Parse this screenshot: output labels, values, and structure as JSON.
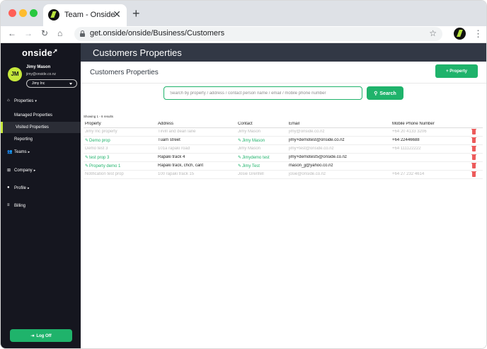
{
  "browser": {
    "tab_title": "Team - Onside",
    "tab_close": "✕",
    "new_tab": "+",
    "url": "get.onside/onside/Business/Customers",
    "back": "←",
    "forward": "→",
    "reload": "↻",
    "home": "⌂",
    "star": "☆",
    "menu": "⋮"
  },
  "sidebar": {
    "logo": "onside",
    "avatar_initials": "JM",
    "user_name": "Jimy Mason",
    "user_email": "jimy@onside.co.nz",
    "business_select": "Jimy Inc",
    "nav": {
      "properties": "Properties",
      "managed_properties": "Managed Properties",
      "visited_properties": "Visited Properties",
      "reporting": "Reporting",
      "teams": "Teams",
      "company": "Company",
      "profile": "Profile",
      "billing": "Billing"
    },
    "logout": "Log Off"
  },
  "main": {
    "header_title": "Customers Properties",
    "page_title": "Customers Properties",
    "add_button": "Property",
    "search": {
      "placeholder": "Search by property / address / contact person name / email / mobile phone number",
      "button": "Search"
    },
    "results_count": "Showing 1 - 6 results",
    "columns": [
      "Property",
      "Address",
      "Contact",
      "Email",
      "Mobile Phone Number"
    ],
    "rows": [
      {
        "property": "Jimy Inc property",
        "address": "Tirvill and dean lane",
        "contact": "Jimy Mason",
        "email": "jimy@onside.co.nz",
        "phone": "+64 20 4133 3206",
        "editable": false
      },
      {
        "property": "Demo prop",
        "address": "Tuam street",
        "contact": "Jimy Mason",
        "email": "jimy+demotest@onside.co.nz",
        "phone": "+64 22446688",
        "editable": true
      },
      {
        "property": "Demo test 3",
        "address": "101a rapaki road",
        "contact": "Jimy Mason",
        "email": "jimy+test@onside.co.nz",
        "phone": "+64 111122222",
        "editable": false
      },
      {
        "property": "test prop 3",
        "address": "Rapaki track 4",
        "contact": "Jimydemo test",
        "email": "jimy+demotest5@onside.co.nz",
        "phone": "",
        "editable": true
      },
      {
        "property": "Property demo 1",
        "address": "Rapaki track, chch, cant",
        "contact": "Jimy Test",
        "email": "mason_jj@yahoo.co.nz",
        "phone": "",
        "editable": true
      },
      {
        "property": "Notification test prop",
        "address": "100 rapaki track 15",
        "contact": "Josie Grenfell",
        "email": "josie@onside.co.nz",
        "phone": "+64 27 232 4614",
        "editable": false
      }
    ]
  },
  "colors": {
    "accent_green": "#1fb36b",
    "sidebar_bg": "#15161f",
    "header_bg": "#323845",
    "avatar_lime": "#c6e83b",
    "delete_red": "#ec5b5b"
  }
}
